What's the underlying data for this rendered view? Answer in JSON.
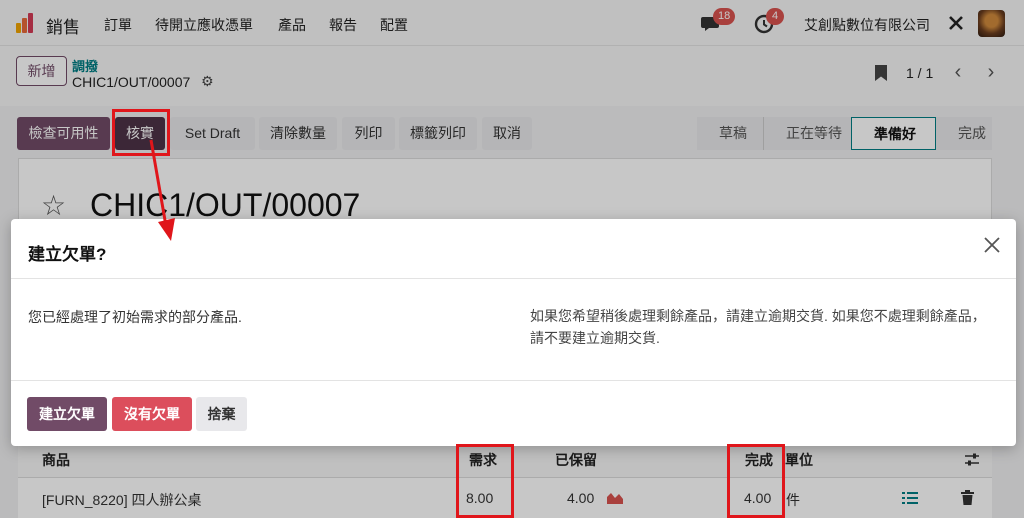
{
  "navbar": {
    "app_name": "銷售",
    "menu": [
      "訂單",
      "待開立應收憑單",
      "產品",
      "報告",
      "配置"
    ],
    "messages_count": "18",
    "activities_count": "4",
    "company": "艾創點數位有限公司"
  },
  "control": {
    "new_label": "新增",
    "breadcrumb_parent": "調撥",
    "breadcrumb_current": "CHIC1/OUT/00007",
    "pager_value": "1 / 1"
  },
  "actions": [
    "檢查可用性",
    "核實",
    "Set Draft",
    "清除數量",
    "列印",
    "標籤列印",
    "取消"
  ],
  "statusbar": [
    "草稿",
    "正在等待",
    "準備好",
    "完成"
  ],
  "record": {
    "title": "CHIC1/OUT/00007"
  },
  "table": {
    "headers": [
      "商品",
      "需求",
      "已保留",
      "完成",
      "單位"
    ],
    "rows": [
      {
        "product": "[FURN_8220] 四人辦公桌",
        "demand": "8.00",
        "reserved": "4.00",
        "done": "4.00",
        "unit": "件"
      }
    ]
  },
  "dialog": {
    "title": "建立欠單?",
    "left_text": "您已經處理了初始需求的部分產品.",
    "right_text_line1": "如果您希望稍後處理剩餘產品，請建立逾期交貨. 如果您不處理剩餘產品，",
    "right_text_line2": "請不要建立逾期交貨.",
    "buttons": [
      "建立欠單",
      "沒有欠單",
      "捨棄"
    ]
  },
  "colors": {
    "primary": "#714B67",
    "danger": "#dc4e5c",
    "teal": "#017e84",
    "annotation_red": "#e0161b"
  }
}
